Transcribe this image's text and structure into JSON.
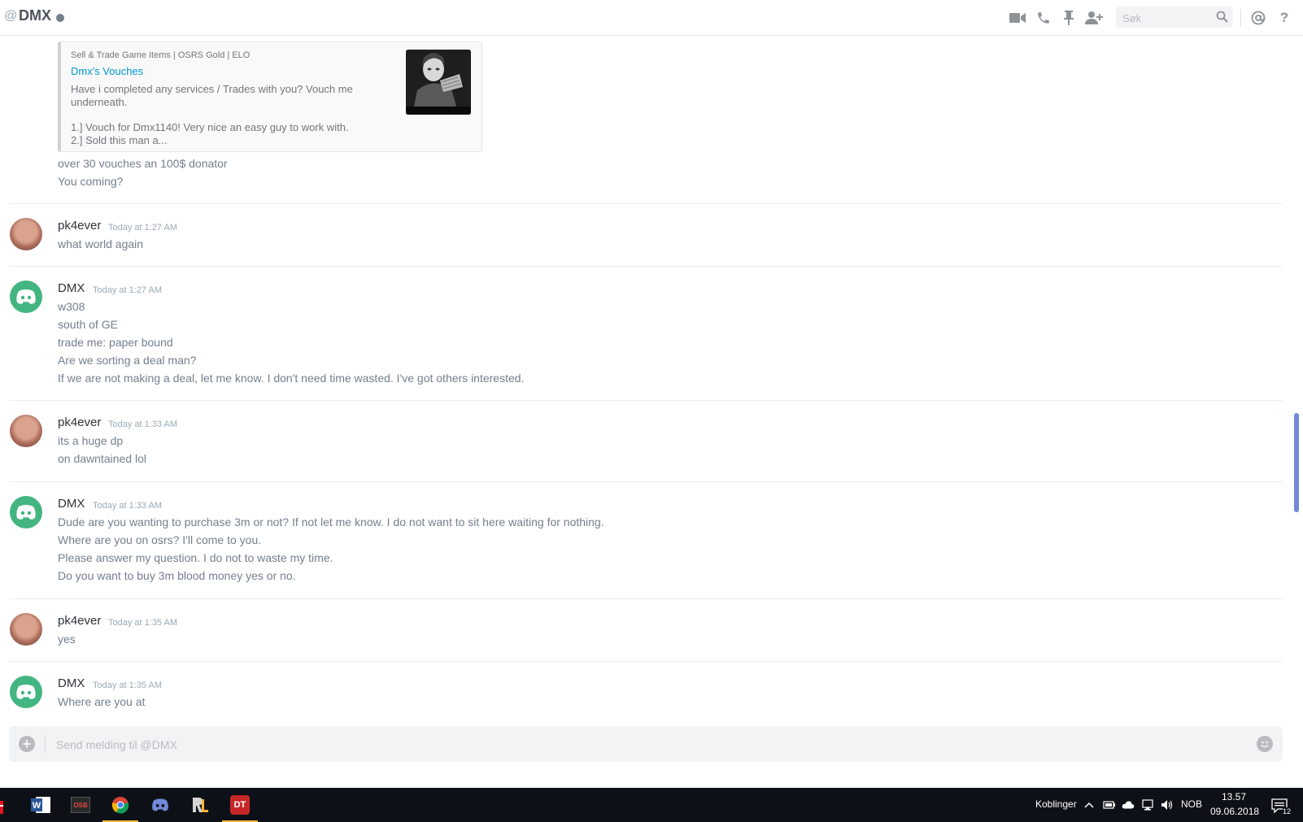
{
  "header": {
    "at_symbol": "@",
    "title": "DMX",
    "search_placeholder": "Søk",
    "icons": [
      "video-call-icon",
      "voice-call-icon",
      "pin-icon",
      "add-friend-icon",
      "search-icon",
      "mention-icon",
      "help-icon"
    ]
  },
  "embed": {
    "provider": "Sell & Trade Game Items | OSRS Gold | ELO",
    "title": "Dmx's Vouches",
    "description_1": "Have i completed any services / Trades with you? Vouch me underneath.",
    "description_2": "1.] Vouch for Dmx1140! Very nice an easy guy to work with.",
    "description_3": "2.] Sold this man a..."
  },
  "messages": [
    {
      "author": "",
      "timestamp": "",
      "lines": [
        "over 30 vouches an 100$ donator",
        "You coming?"
      ]
    },
    {
      "author": "pk4ever",
      "timestamp": "Today at 1:27 AM",
      "lines": [
        "what world again"
      ]
    },
    {
      "author": "DMX",
      "timestamp": "Today at 1:27 AM",
      "lines": [
        "w308",
        "south of GE",
        "trade me: paper bound",
        "Are we sorting a deal man?",
        "If we are not making a deal, let me know. I don't need time wasted. I've got others interested."
      ]
    },
    {
      "author": "pk4ever",
      "timestamp": "Today at 1:33 AM",
      "lines": [
        "its a huge dp",
        "on dawntained lol"
      ]
    },
    {
      "author": "DMX",
      "timestamp": "Today at 1:33 AM",
      "lines": [
        "Dude are you wanting to purchase 3m or not? If not let me know. I do not want to sit here waiting for nothing.",
        "Where are you on osrs? I'll come to you.",
        "Please answer my question. I do not to waste my time.",
        "Do you want to buy 3m blood money yes or no."
      ]
    },
    {
      "author": "pk4ever",
      "timestamp": "Today at 1:35 AM",
      "lines": [
        "yes"
      ]
    },
    {
      "author": "DMX",
      "timestamp": "Today at 1:35 AM",
      "lines": [
        "Where are you at"
      ]
    }
  ],
  "composer": {
    "placeholder": "Send melding til @DMX"
  },
  "taskbar": {
    "apps": [
      "word",
      "osb",
      "chrome",
      "discord",
      "runelite",
      "dt"
    ],
    "osb_label": "OSB",
    "dt_label": "DT",
    "links_label": "Koblinger",
    "language": "NOB",
    "time": "13.57",
    "date": "09.06.2018",
    "notification_count": "12"
  },
  "colors": {
    "accent": "#7289da",
    "link": "#0096cf",
    "discord_green": "#43b581",
    "taskbar": "#0d1117"
  }
}
